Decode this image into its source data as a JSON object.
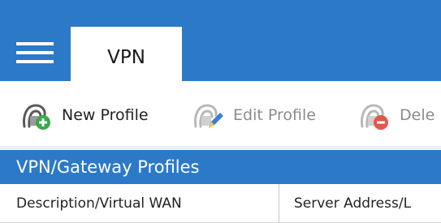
{
  "app": {
    "menu_icon": "hamburger-menu-icon",
    "tabs": [
      {
        "label": "VPN",
        "active": true
      }
    ]
  },
  "toolbar": {
    "items": [
      {
        "label": "New Profile",
        "icon": "new-profile-icon",
        "enabled": true
      },
      {
        "label": "Edit Profile",
        "icon": "edit-profile-icon",
        "enabled": false
      },
      {
        "label": "Dele",
        "icon": "delete-profile-icon",
        "enabled": false
      }
    ]
  },
  "section": {
    "title": "VPN/Gateway Profiles"
  },
  "table": {
    "columns": [
      "Description/Virtual WAN",
      "Server Address/L"
    ]
  },
  "colors": {
    "accent": "#2c79c8",
    "add_badge": "#3aa84a",
    "edit_pencil": "#3a7fd0",
    "delete_badge": "#e2574c",
    "disabled_text": "#8c8c8c"
  }
}
